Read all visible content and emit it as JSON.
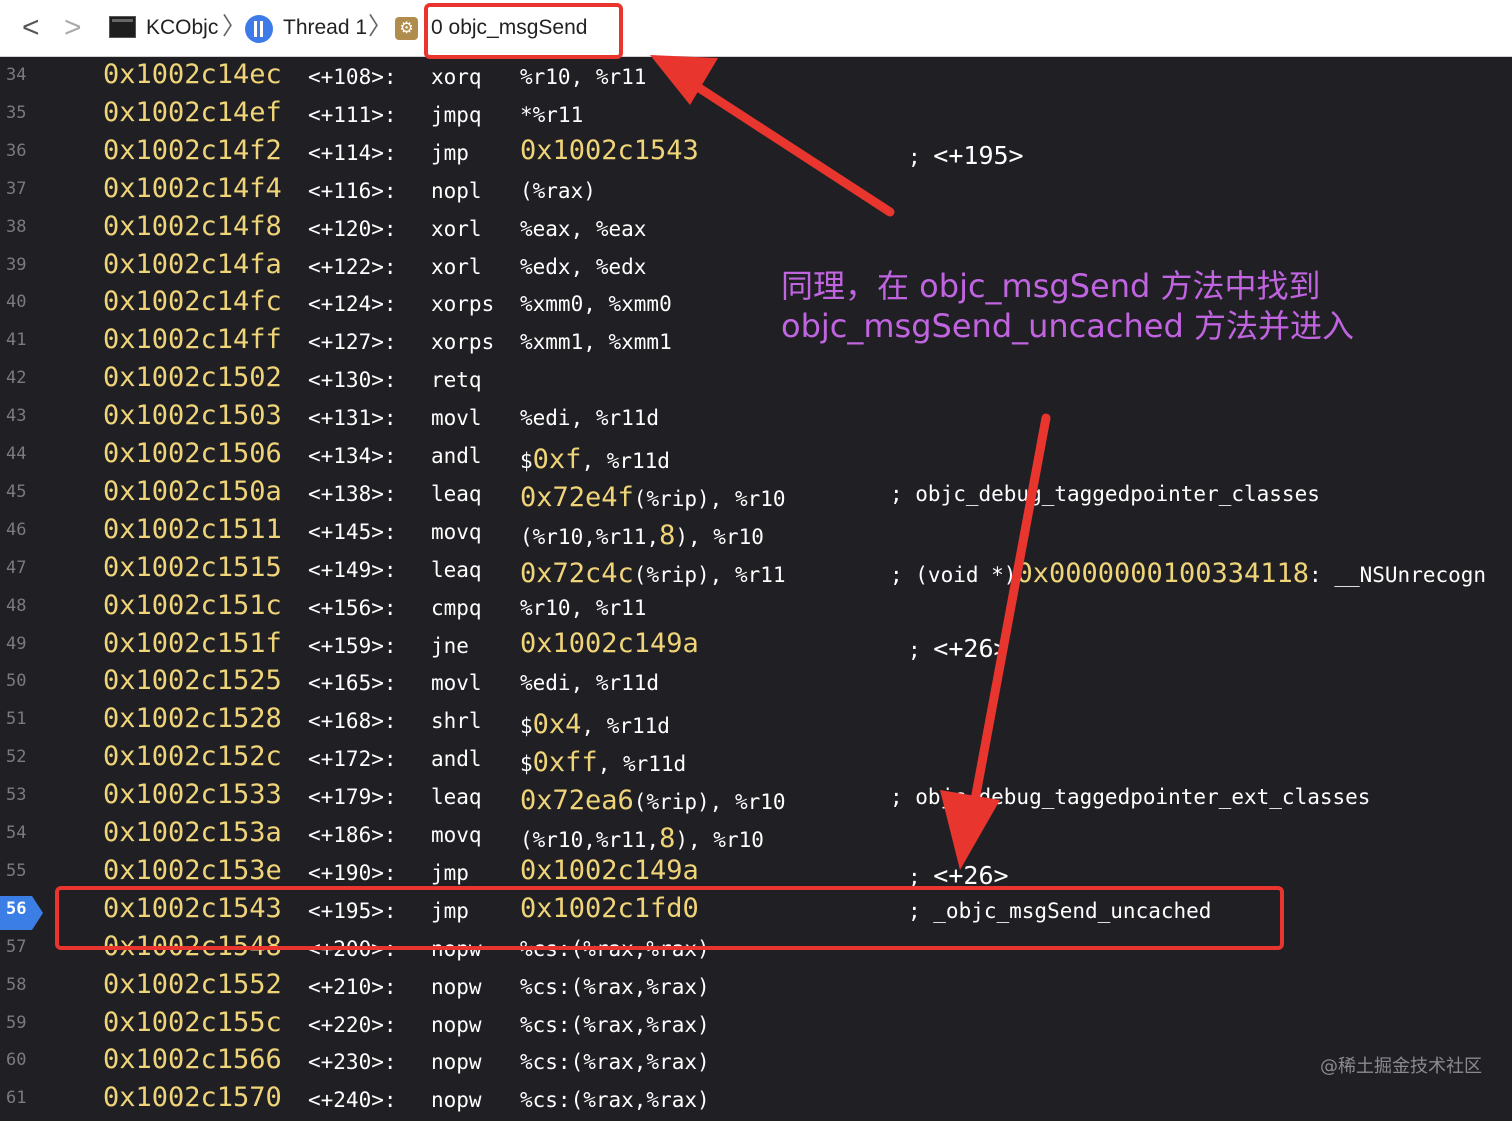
{
  "jumpbar": {
    "back_label": "<",
    "forward_label": ">",
    "project": "KCObjc",
    "thread": "Thread 1",
    "frame": "0 objc_msgSend",
    "separator": "〉"
  },
  "code": {
    "current_line": "56",
    "lines": [
      {
        "n": "34",
        "addr": "0x1002c14ec",
        "off": "<+108>:",
        "mn": "xorq",
        "op": "%r10, %r11",
        "cm": ""
      },
      {
        "n": "35",
        "addr": "0x1002c14ef",
        "off": "<+111>:",
        "mn": "jmpq",
        "op": "*%r11",
        "cm": ""
      },
      {
        "n": "36",
        "addr": "0x1002c14f2",
        "off": "<+114>:",
        "mn": "jmp",
        "op": "0x1002c1543",
        "cm": "; <+195>"
      },
      {
        "n": "37",
        "addr": "0x1002c14f4",
        "off": "<+116>:",
        "mn": "nopl",
        "op": "(%rax)",
        "cm": ""
      },
      {
        "n": "38",
        "addr": "0x1002c14f8",
        "off": "<+120>:",
        "mn": "xorl",
        "op": "%eax, %eax",
        "cm": ""
      },
      {
        "n": "39",
        "addr": "0x1002c14fa",
        "off": "<+122>:",
        "mn": "xorl",
        "op": "%edx, %edx",
        "cm": ""
      },
      {
        "n": "40",
        "addr": "0x1002c14fc",
        "off": "<+124>:",
        "mn": "xorps",
        "op": "%xmm0, %xmm0",
        "cm": ""
      },
      {
        "n": "41",
        "addr": "0x1002c14ff",
        "off": "<+127>:",
        "mn": "xorps",
        "op": "%xmm1, %xmm1",
        "cm": ""
      },
      {
        "n": "42",
        "addr": "0x1002c1502",
        "off": "<+130>:",
        "mn": "retq",
        "op": "",
        "cm": ""
      },
      {
        "n": "43",
        "addr": "0x1002c1503",
        "off": "<+131>:",
        "mn": "movl",
        "op": "%edi, %r11d",
        "cm": ""
      },
      {
        "n": "44",
        "addr": "0x1002c1506",
        "off": "<+134>:",
        "mn": "andl",
        "op": "$0xf, %r11d",
        "cm": ""
      },
      {
        "n": "45",
        "addr": "0x1002c150a",
        "off": "<+138>:",
        "mn": "leaq",
        "op": "0x72e4f(%rip), %r10",
        "cm": "; objc_debug_taggedpointer_classes"
      },
      {
        "n": "46",
        "addr": "0x1002c1511",
        "off": "<+145>:",
        "mn": "movq",
        "op": "(%r10,%r11,8), %r10",
        "cm": ""
      },
      {
        "n": "47",
        "addr": "0x1002c1515",
        "off": "<+149>:",
        "mn": "leaq",
        "op": "0x72c4c(%rip), %r11",
        "cm": "; (void *)0x0000000100334118: __NSUnrecogn"
      },
      {
        "n": "48",
        "addr": "0x1002c151c",
        "off": "<+156>:",
        "mn": "cmpq",
        "op": "%r10, %r11",
        "cm": ""
      },
      {
        "n": "49",
        "addr": "0x1002c151f",
        "off": "<+159>:",
        "mn": "jne",
        "op": "0x1002c149a",
        "cm": "; <+26>"
      },
      {
        "n": "50",
        "addr": "0x1002c1525",
        "off": "<+165>:",
        "mn": "movl",
        "op": "%edi, %r11d",
        "cm": ""
      },
      {
        "n": "51",
        "addr": "0x1002c1528",
        "off": "<+168>:",
        "mn": "shrl",
        "op": "$0x4, %r11d",
        "cm": ""
      },
      {
        "n": "52",
        "addr": "0x1002c152c",
        "off": "<+172>:",
        "mn": "andl",
        "op": "$0xff, %r11d",
        "cm": ""
      },
      {
        "n": "53",
        "addr": "0x1002c1533",
        "off": "<+179>:",
        "mn": "leaq",
        "op": "0x72ea6(%rip), %r10",
        "cm": "; objc_debug_taggedpointer_ext_classes"
      },
      {
        "n": "54",
        "addr": "0x1002c153a",
        "off": "<+186>:",
        "mn": "movq",
        "op": "(%r10,%r11,8), %r10",
        "cm": ""
      },
      {
        "n": "55",
        "addr": "0x1002c153e",
        "off": "<+190>:",
        "mn": "jmp",
        "op": "0x1002c149a",
        "cm": "; <+26>"
      },
      {
        "n": "56",
        "addr": "0x1002c1543",
        "off": "<+195>:",
        "mn": "jmp",
        "op": "0x1002c1fd0",
        "cm": "; _objc_msgSend_uncached"
      },
      {
        "n": "57",
        "addr": "0x1002c1548",
        "off": "<+200>:",
        "mn": "nopw",
        "op": "%cs:(%rax,%rax)",
        "cm": ""
      },
      {
        "n": "58",
        "addr": "0x1002c1552",
        "off": "<+210>:",
        "mn": "nopw",
        "op": "%cs:(%rax,%rax)",
        "cm": ""
      },
      {
        "n": "59",
        "addr": "0x1002c155c",
        "off": "<+220>:",
        "mn": "nopw",
        "op": "%cs:(%rax,%rax)",
        "cm": ""
      },
      {
        "n": "60",
        "addr": "0x1002c1566",
        "off": "<+230>:",
        "mn": "nopw",
        "op": "%cs:(%rax,%rax)",
        "cm": ""
      },
      {
        "n": "61",
        "addr": "0x1002c1570",
        "off": "<+240>:",
        "mn": "nopw",
        "op": "%cs:(%rax,%rax)",
        "cm": ""
      }
    ]
  },
  "annotation": {
    "line1": "同理，在 objc_msgSend 方法中找到",
    "line2": "objc_msgSend_uncached 方法并进入",
    "color": "#c064e0",
    "box_color": "#e8352e"
  },
  "watermark": "@稀土掘金技术社区"
}
